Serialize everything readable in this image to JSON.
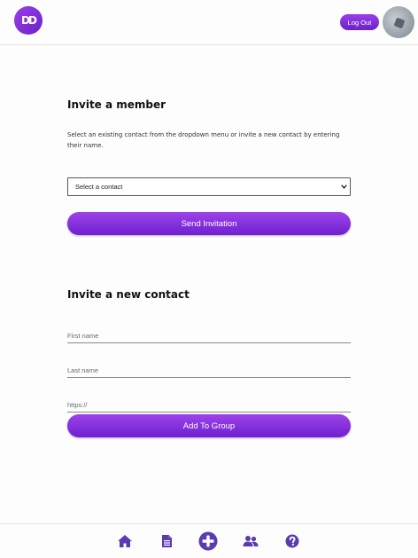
{
  "header": {
    "logo_text": "DD",
    "logout_label": "Log Out",
    "avatar_alt": "user avatar"
  },
  "invite_member": {
    "title": "Invite a member",
    "help_text": "Select an existing contact from the dropdown menu or invite a new contact by entering their name.",
    "select": {
      "selected_value": "Select a contact"
    },
    "send_button_label": "Send Invitation"
  },
  "invite_contact": {
    "title": "Invite a new contact",
    "first_name_placeholder": "First name",
    "last_name_placeholder": "Last name",
    "url_placeholder": "https://",
    "add_button_label": "Add To Group"
  },
  "bottom_nav": {
    "items": [
      {
        "icon": "home-icon"
      },
      {
        "icon": "document-icon"
      },
      {
        "icon": "plus-circle-icon"
      },
      {
        "icon": "group-icon"
      },
      {
        "icon": "help-icon"
      }
    ]
  },
  "colors": {
    "accent": "#7b2ad6",
    "accent_light": "#9d43ea",
    "nav_icon": "#5b3bb0"
  }
}
